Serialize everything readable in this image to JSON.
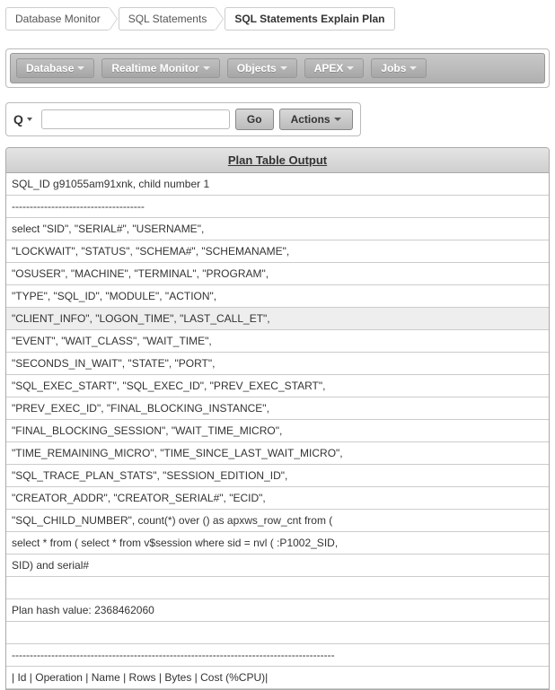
{
  "breadcrumb": {
    "items": [
      "Database Monitor",
      "SQL Statements",
      "SQL Statements Explain Plan"
    ]
  },
  "menubar": {
    "items": [
      "Database",
      "Realtime Monitor",
      "Objects",
      "APEX",
      "Jobs"
    ]
  },
  "search": {
    "placeholder": "",
    "value": "",
    "go_label": "Go",
    "actions_label": "Actions"
  },
  "plan_table": {
    "header": "Plan Table Output",
    "rows": [
      "SQL_ID g91055am91xnk, child number 1",
      "-------------------------------------",
      "select \"SID\", \"SERIAL#\", \"USERNAME\",",
      "\"LOCKWAIT\", \"STATUS\", \"SCHEMA#\", \"SCHEMANAME\",",
      "\"OSUSER\", \"MACHINE\", \"TERMINAL\", \"PROGRAM\",",
      "\"TYPE\", \"SQL_ID\", \"MODULE\", \"ACTION\",",
      "\"CLIENT_INFO\", \"LOGON_TIME\", \"LAST_CALL_ET\",",
      "\"EVENT\", \"WAIT_CLASS\", \"WAIT_TIME\",",
      "\"SECONDS_IN_WAIT\", \"STATE\", \"PORT\",",
      "\"SQL_EXEC_START\", \"SQL_EXEC_ID\", \"PREV_EXEC_START\",",
      "\"PREV_EXEC_ID\", \"FINAL_BLOCKING_INSTANCE\",",
      "\"FINAL_BLOCKING_SESSION\", \"WAIT_TIME_MICRO\",",
      "\"TIME_REMAINING_MICRO\", \"TIME_SINCE_LAST_WAIT_MICRO\",",
      "\"SQL_TRACE_PLAN_STATS\", \"SESSION_EDITION_ID\",",
      "\"CREATOR_ADDR\", \"CREATOR_SERIAL#\", \"ECID\",",
      "\"SQL_CHILD_NUMBER\", count(*) over () as apxws_row_cnt from (",
      "select * from ( select * from v$session where sid = nvl ( :P1002_SID,",
      "SID) and serial#",
      "",
      "Plan hash value: 2368462060",
      "",
      "------------------------------------------------------------------------------------------",
      "| Id | Operation | Name | Rows | Bytes | Cost (%CPU)|"
    ],
    "alt_indices": [
      6
    ]
  }
}
